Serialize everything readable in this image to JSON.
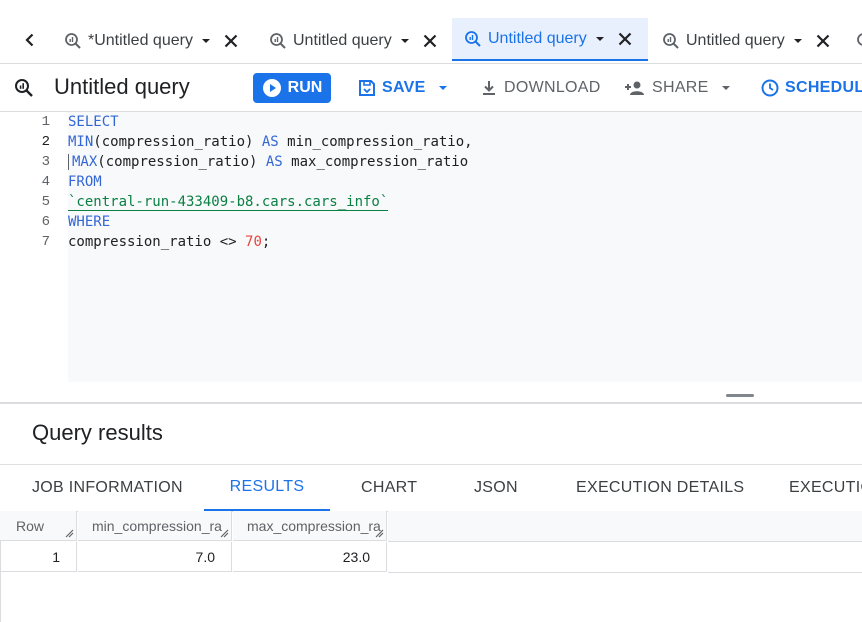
{
  "tabs": [
    {
      "label": "*Untitled query",
      "active": false
    },
    {
      "label": "Untitled query",
      "active": false
    },
    {
      "label": "Untitled query",
      "active": true
    },
    {
      "label": "Untitled query",
      "active": false
    }
  ],
  "toolbar": {
    "title": "Untitled query",
    "run_label": "RUN",
    "save_label": "SAVE",
    "download_label": "DOWNLOAD",
    "share_label": "SHARE",
    "schedule_label": "SCHEDULE"
  },
  "editor": {
    "line_numbers": [
      "1",
      "2",
      "3",
      "4",
      "5",
      "6",
      "7"
    ],
    "lines": {
      "l1_kw": "SELECT",
      "l2_fn": "MIN",
      "l2_rest": "(compression_ratio) ",
      "l2_as": "AS",
      "l2_alias": " min_compression_ratio,",
      "l3_fn": "MAX",
      "l3_rest": "(compression_ratio) ",
      "l3_as": "AS",
      "l3_alias": " max_compression_ratio",
      "l4_kw": "FROM",
      "l5_table": "`central-run-433409-b8.cars.cars_info`",
      "l6_kw": "WHERE",
      "l7_col": "compression_ratio <> ",
      "l7_num": "70",
      "l7_end": ";"
    }
  },
  "results": {
    "title": "Query results",
    "tabs": [
      "JOB INFORMATION",
      "RESULTS",
      "CHART",
      "JSON",
      "EXECUTION DETAILS",
      "EXECUTIO"
    ],
    "active_tab": "RESULTS",
    "columns": [
      "Row",
      "min_compression_ra",
      "max_compression_ra"
    ],
    "rows": [
      {
        "row": "1",
        "min": "7.0",
        "max": "23.0"
      }
    ]
  },
  "colors": {
    "accent": "#1a73e8",
    "keyword": "#3367d6",
    "string": "#0b8043",
    "number": "#e8453c"
  },
  "icons": [
    "chevron-left-icon",
    "query-icon",
    "dropdown-arrow-icon",
    "close-icon",
    "play-icon",
    "save-icon",
    "download-icon",
    "add-person-icon",
    "clock-icon",
    "resize-handle-icon"
  ]
}
